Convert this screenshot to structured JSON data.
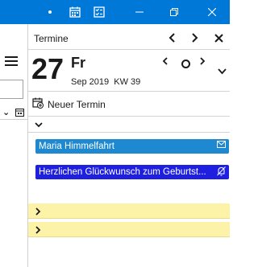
{
  "window": {
    "icons": [
      "pin-icon",
      "calendar-icon",
      "tasks-icon"
    ],
    "controls": [
      "minimize-icon",
      "restore-icon",
      "close-icon"
    ]
  },
  "pane": {
    "title": "Termine",
    "day_number": "27",
    "weekday": "Fr",
    "month_year": "Sep 2019",
    "week": "KW 39",
    "new_appointment_label": "Neuer Termin",
    "events": [
      {
        "title": "Maria Himmelfahrt",
        "color": "#1e88d0",
        "icon": "envelope-icon"
      },
      {
        "title": "Herzlichen Glückwunsch zum Geburtst...",
        "color": "#1f1fe0",
        "icon": "bell-off-icon"
      }
    ]
  },
  "colors": {
    "titlebar": "#0078d7",
    "highlight_row": "#fdf3a8"
  }
}
